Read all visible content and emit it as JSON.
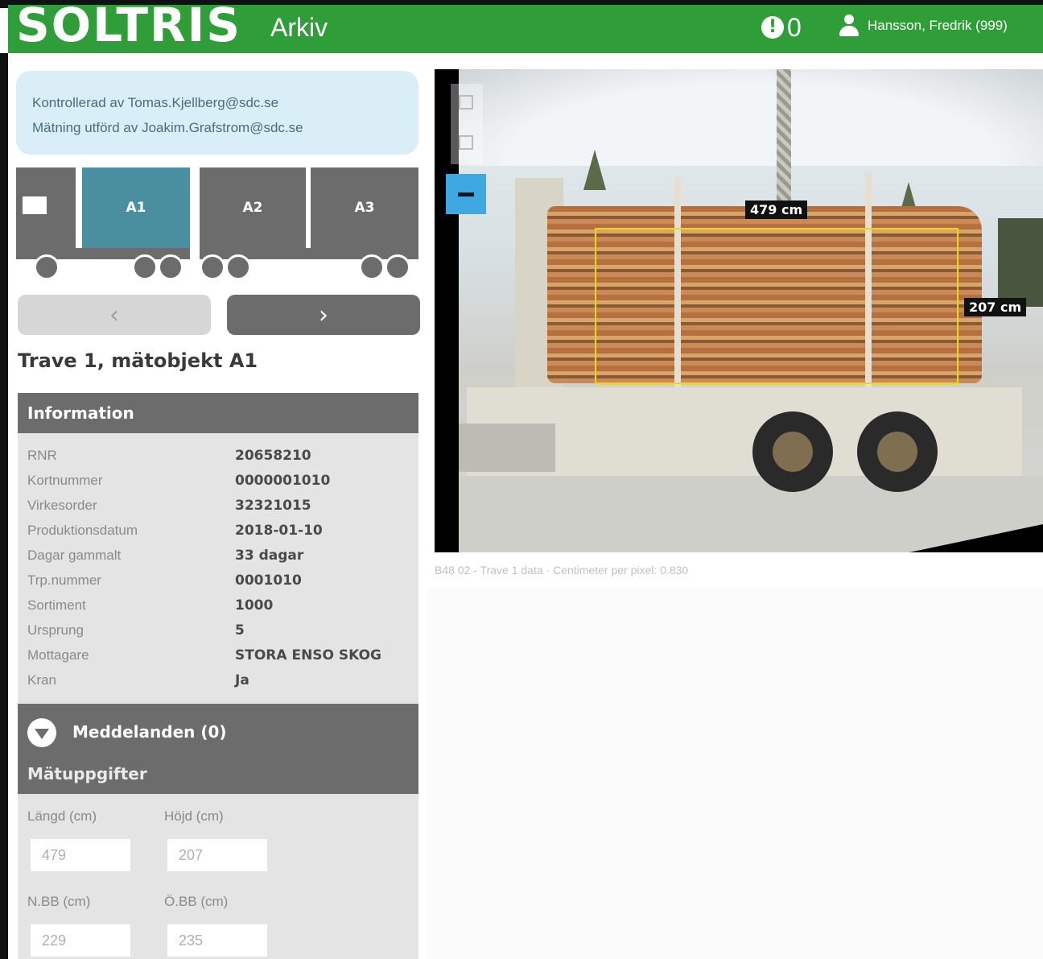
{
  "header": {
    "logo": "SOLTRIS",
    "app_title": "Arkiv",
    "alert_icon": "exclamation-icon",
    "alert_symbol": "!",
    "alert_count": "0",
    "user_icon": "user-icon",
    "user_name": "Hansson, Fredrik (999)",
    "color": "#2f9e39"
  },
  "control_box": {
    "line1": "Kontrollerad av Tomas.Kjellberg@sdc.se",
    "line2": "Mätning utförd av Joakim.Grafstrom@sdc.se"
  },
  "truck": {
    "segments": [
      {
        "label": "A1",
        "active": true
      },
      {
        "label": "A2",
        "active": false
      },
      {
        "label": "A3",
        "active": false
      }
    ],
    "active_color": "#4a8fa0"
  },
  "nav": {
    "prev": "‹",
    "next": "›"
  },
  "section_title": "Trave 1, mätobjekt A1",
  "information": {
    "title": "Information",
    "rows": [
      {
        "key": "RNR",
        "value": "20658210"
      },
      {
        "key": "Kortnummer",
        "value": "0000001010"
      },
      {
        "key": "Virkesorder",
        "value": "32321015"
      },
      {
        "key": "Produktionsdatum",
        "value": "2018-01-10"
      },
      {
        "key": "Dagar gammalt",
        "value": "33 dagar"
      },
      {
        "key": "Trp.nummer",
        "value": "0001010"
      },
      {
        "key": "Sortiment",
        "value": "1000"
      },
      {
        "key": "Ursprung",
        "value": "5"
      },
      {
        "key": "Mottagare",
        "value": "STORA ENSO SKOG"
      },
      {
        "key": "Kran",
        "value": "Ja"
      }
    ]
  },
  "messages": {
    "label": "Meddelanden (0)"
  },
  "measurements": {
    "title": "Mätuppgifter",
    "fields": [
      {
        "label": "Längd (cm)",
        "value": "479"
      },
      {
        "label": "Höjd (cm)",
        "value": "207"
      },
      {
        "label": "N.BB (cm)",
        "value": "229"
      },
      {
        "label": "Ö.BB (cm)",
        "value": "235"
      }
    ]
  },
  "viewer": {
    "length_label": "479 cm",
    "height_label": "207 cm",
    "caption": "B48 02 - Trave 1 data  ·  Centimeter per pixel: 0.830"
  }
}
